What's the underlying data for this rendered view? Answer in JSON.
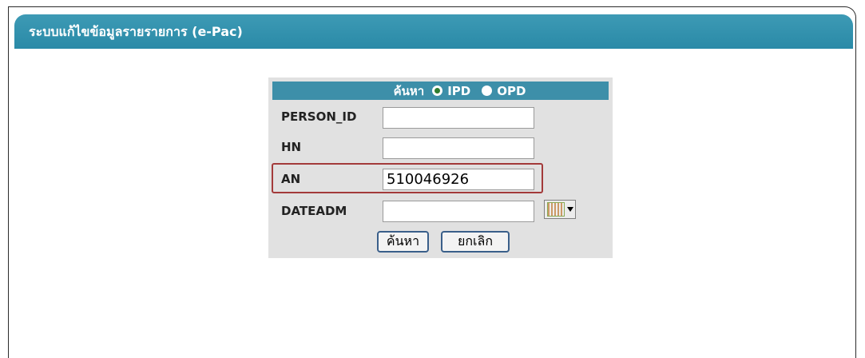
{
  "window": {
    "title": "ระบบแก้ไขข้อมูลรายรายการ (e-Pac)"
  },
  "search_panel": {
    "header_label": "ค้นหา",
    "options": [
      {
        "label": "IPD",
        "selected": true
      },
      {
        "label": "OPD",
        "selected": false
      }
    ],
    "fields": {
      "person_id": {
        "label": "PERSON_ID",
        "value": ""
      },
      "hn": {
        "label": "HN",
        "value": ""
      },
      "an": {
        "label": "AN",
        "value": "510046926"
      },
      "dateadm": {
        "label": "DATEADM",
        "value": ""
      }
    },
    "buttons": {
      "search": "ค้นหา",
      "cancel": "ยกเลิก"
    },
    "calendar_icon": "calendar-icon"
  },
  "colors": {
    "titlebar": "#2a8aa7",
    "panel_header": "#3d8fa9",
    "panel_bg": "#e1e1e1",
    "highlight": "#a33a3a"
  }
}
